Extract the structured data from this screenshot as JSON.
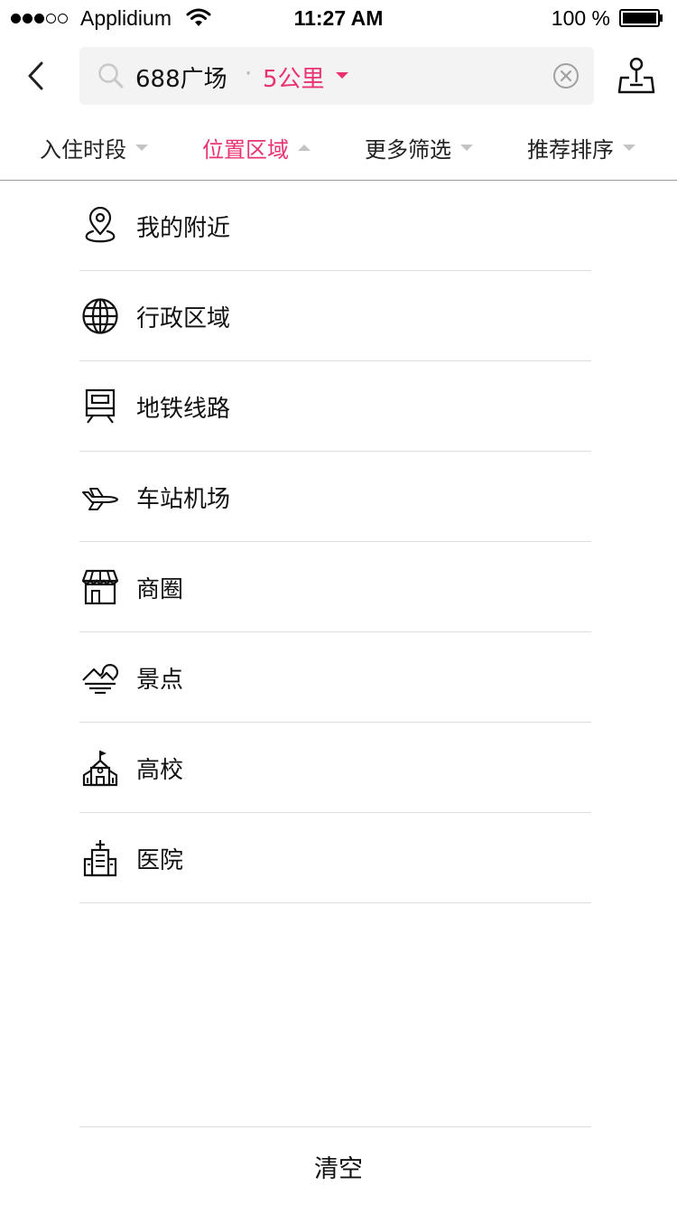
{
  "status_bar": {
    "carrier": "Applidium",
    "time": "11:27 AM",
    "battery": "100 %",
    "signal_bars_full": 3,
    "signal_bars_total": 5
  },
  "header": {
    "back_icon": "chevron-left-icon",
    "search": {
      "keyword": "688广场",
      "separator": "·",
      "distance": "5公里",
      "search_icon": "search-icon",
      "clear_icon": "clear-circle-icon"
    },
    "map_icon": "map-pin-icon"
  },
  "filters": {
    "tabs": [
      {
        "label": "入住时段",
        "active": false
      },
      {
        "label": "位置区域",
        "active": true
      },
      {
        "label": "更多筛选",
        "active": false
      },
      {
        "label": "推荐排序",
        "active": false
      }
    ]
  },
  "locations": {
    "items": [
      {
        "label": "我的附近",
        "icon": "location-pin-icon"
      },
      {
        "label": "行政区域",
        "icon": "globe-icon"
      },
      {
        "label": "地铁线路",
        "icon": "subway-icon"
      },
      {
        "label": "车站机场",
        "icon": "airplane-icon"
      },
      {
        "label": "商圈",
        "icon": "shop-icon"
      },
      {
        "label": "景点",
        "icon": "scenery-icon"
      },
      {
        "label": "高校",
        "icon": "school-icon"
      },
      {
        "label": "医院",
        "icon": "hospital-icon"
      }
    ]
  },
  "footer": {
    "clear_label": "清空"
  },
  "colors": {
    "accent": "#e8336f",
    "text": "#111111",
    "divider": "#dddddd",
    "search_bg": "#f3f3f3"
  }
}
